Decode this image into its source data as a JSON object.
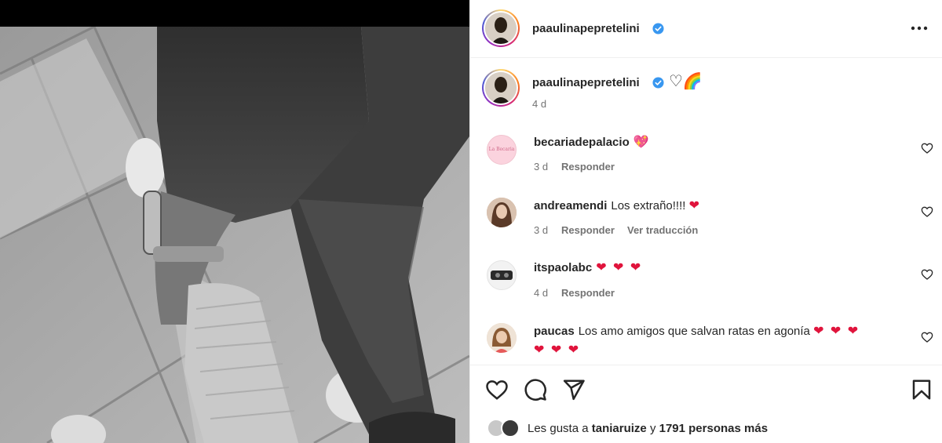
{
  "post": {
    "author": "paaulinapepretelini",
    "caption_username": "paaulinapepretelini",
    "caption_text": "♡🌈",
    "caption_time": "4 d"
  },
  "comments": [
    {
      "username": "becariadepalacio",
      "text": "",
      "emoji": "💖",
      "time": "3 d",
      "reply": "Responder",
      "translate": "",
      "avatar_text": "La Becaria"
    },
    {
      "username": "andreamendi",
      "text": "Los extraño!!!!",
      "emoji": "❤",
      "time": "3 d",
      "reply": "Responder",
      "translate": "Ver traducción",
      "avatar_text": ""
    },
    {
      "username": "itspaolabc",
      "text": "",
      "emoji": "❤ ❤ ❤",
      "time": "4 d",
      "reply": "Responder",
      "translate": "",
      "avatar_text": ""
    },
    {
      "username": "paucas",
      "text": "Los amo amigos que salvan ratas en agonía",
      "emoji": "❤ ❤ ❤",
      "emoji_line2": "❤ ❤ ❤",
      "time": "",
      "reply": "",
      "translate": "",
      "avatar_text": ""
    }
  ],
  "likes": {
    "prefix": "Les gusta a",
    "user": "taniaruize",
    "connector": "y",
    "count_text": "1791 personas más"
  },
  "colors": {
    "verified": "#3897f0",
    "heart_red": "#e0143c",
    "muted": "#737373"
  }
}
